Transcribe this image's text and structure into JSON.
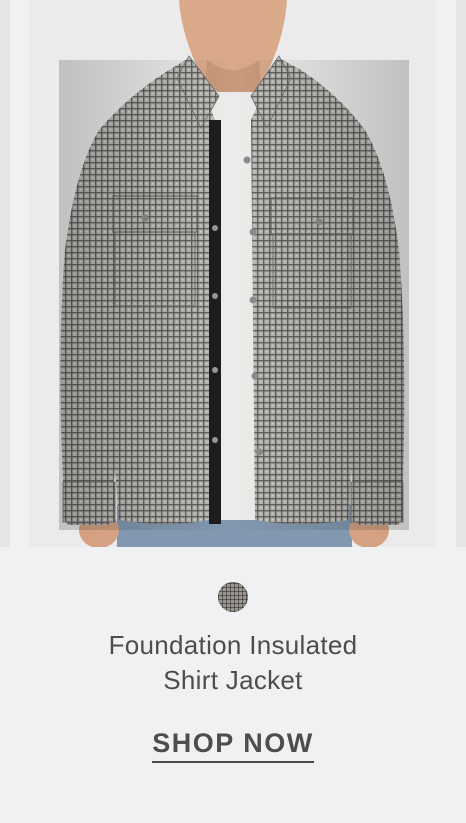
{
  "product": {
    "image_alt": "Man wearing a grey houndstooth snap-front shirt jacket over a white tee",
    "swatch_color": "#9a9690",
    "title_line1": "Foundation Insulated",
    "title_line2": "Shirt Jacket",
    "cta_label": "SHOP NOW"
  }
}
